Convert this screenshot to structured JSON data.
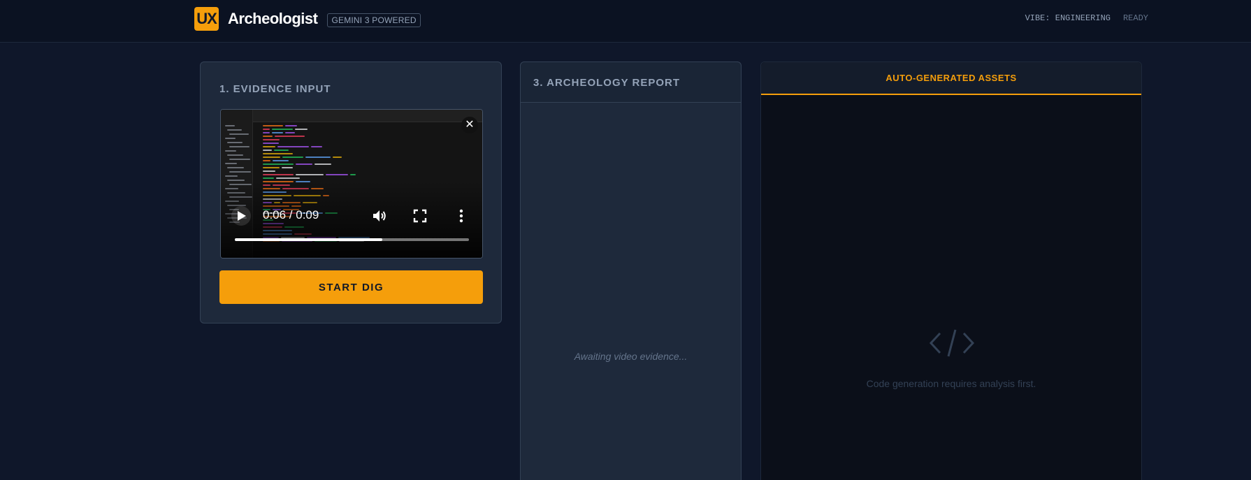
{
  "header": {
    "logo_text": "UX",
    "app_title": "Archeologist",
    "powered_badge": "GEMINI 3 POWERED",
    "vibe_label": "VIBE: ENGINEERING",
    "status": "READY"
  },
  "evidence": {
    "heading": "1. EVIDENCE INPUT",
    "video": {
      "time": "0:06 / 0:09",
      "progress": 0.63,
      "icons": {
        "close": "close-icon",
        "play": "play-icon",
        "volume": "volume-icon",
        "fullscreen": "fullscreen-icon",
        "menu": "more-vertical-icon"
      }
    },
    "start_button": "START DIG"
  },
  "report": {
    "heading": "3. ARCHEOLOGY REPORT",
    "placeholder": "Awaiting video evidence..."
  },
  "assets": {
    "tab_label": "AUTO-GENERATED ASSETS",
    "icon": "code-icon",
    "empty_message": "Code generation requires analysis first."
  },
  "colors": {
    "accent": "#f59e0b",
    "background": "#0f172a",
    "panel": "#1e293b"
  }
}
